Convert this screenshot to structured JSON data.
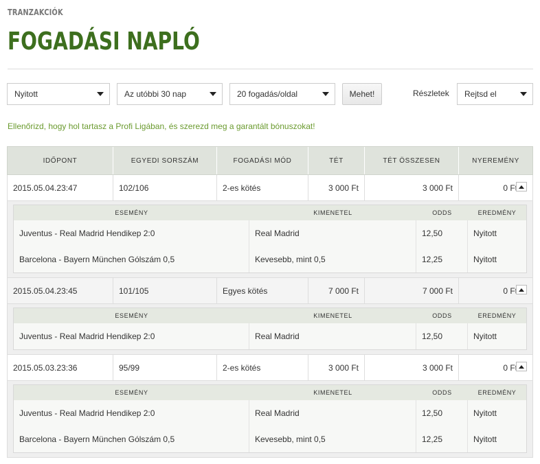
{
  "breadcrumb": "TRANZAKCIÓK",
  "title": "FOGADÁSI NAPLÓ",
  "filters": {
    "status": "Nyitott",
    "period": "Az utóbbi 30 nap",
    "per_page": "20 fogadás/oldal",
    "go_label": "Mehet!",
    "details_label": "Részletek",
    "details_value": "Rejtsd el"
  },
  "promo": "Ellenőrizd, hogy hol tartasz a Profi Ligában, és szerezd meg a garantált bónuszokat!",
  "table": {
    "headers": [
      "IDŐPONT",
      "EGYEDI SORSZÁM",
      "FOGADÁSI MÓD",
      "TÉT",
      "TÉT ÖSSZESEN",
      "NYEREMÉNY"
    ],
    "detail_headers": [
      "ESEMÉNY",
      "KIMENETEL",
      "ODDS",
      "EREDMÉNY"
    ],
    "rows": [
      {
        "time": "2015.05.04.23:47",
        "id": "102/106",
        "mode": "2-es kötés",
        "stake": "3 000 Ft",
        "total": "3 000 Ft",
        "win": "0 Ft",
        "events": [
          {
            "event": "Juventus - Real Madrid Hendikep 2:0",
            "outcome": "Real Madrid",
            "odds": "12,50",
            "result": "Nyitott"
          },
          {
            "event": "Barcelona - Bayern München Gólszám 0,5",
            "outcome": "Kevesebb, mint 0,5",
            "odds": "12,25",
            "result": "Nyitott"
          }
        ]
      },
      {
        "time": "2015.05.04.23:45",
        "id": "101/105",
        "mode": "Egyes kötés",
        "stake": "7 000 Ft",
        "total": "7 000 Ft",
        "win": "0 Ft",
        "events": [
          {
            "event": "Juventus - Real Madrid Hendikep 2:0",
            "outcome": "Real Madrid",
            "odds": "12,50",
            "result": "Nyitott"
          }
        ]
      },
      {
        "time": "2015.05.03.23:36",
        "id": "95/99",
        "mode": "2-es kötés",
        "stake": "3 000 Ft",
        "total": "3 000 Ft",
        "win": "0 Ft",
        "events": [
          {
            "event": "Juventus - Real Madrid Hendikep 2:0",
            "outcome": "Real Madrid",
            "odds": "12,50",
            "result": "Nyitott"
          },
          {
            "event": "Barcelona - Bayern München Gólszám 0,5",
            "outcome": "Kevesebb, mint 0,5",
            "odds": "12,25",
            "result": "Nyitott"
          }
        ]
      }
    ]
  }
}
